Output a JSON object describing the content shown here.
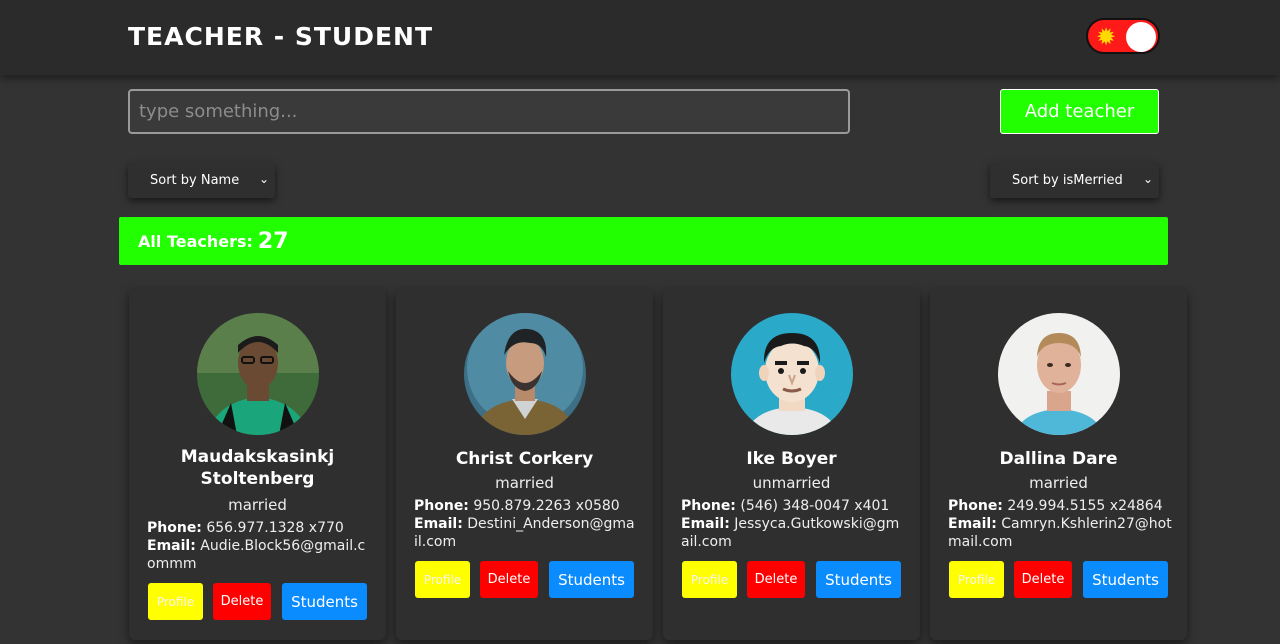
{
  "header": {
    "title": "TEACHER - STUDENT",
    "theme_toggle_icon": "sun-icon",
    "colors": {
      "toggle_bg": "#ff1a1a",
      "sun": "#ffd900"
    }
  },
  "search": {
    "placeholder": "type something..."
  },
  "add_button": {
    "label": "Add teacher",
    "color": "#22ff00"
  },
  "sort_name": {
    "selected": "Sort by Name"
  },
  "sort_married": {
    "selected": "Sort by isMerried"
  },
  "summary": {
    "label": "All Teachers:",
    "count": "27",
    "color": "#22ff00"
  },
  "teachers": [
    {
      "name": "Maudakskasinkj Stoltenberg",
      "status": "married",
      "phone_label": "Phone:",
      "phone": "656.977.1328 x770",
      "email_label": "Email:",
      "email": "Audie.Block56@gmail.commm",
      "profile_label": "Profile",
      "delete_label": "Delete",
      "students_label": "Students"
    },
    {
      "name": "Christ Corkery",
      "status": "married",
      "phone_label": "Phone:",
      "phone": "950.879.2263 x0580",
      "email_label": "Email:",
      "email": "Destini_Anderson@gmail.com",
      "profile_label": "Profile",
      "delete_label": "Delete",
      "students_label": "Students"
    },
    {
      "name": "Ike Boyer",
      "status": "unmarried",
      "phone_label": "Phone:",
      "phone": "(546) 348-0047 x401",
      "email_label": "Email:",
      "email": "Jessyca.Gutkowski@gmail.com",
      "profile_label": "Profile",
      "delete_label": "Delete",
      "students_label": "Students"
    },
    {
      "name": "Dallina Dare",
      "status": "married",
      "phone_label": "Phone:",
      "phone": "249.994.5155 x24864",
      "email_label": "Email:",
      "email": "Camryn.Kshlerin27@hotmail.com",
      "profile_label": "Profile",
      "delete_label": "Delete",
      "students_label": "Students"
    }
  ]
}
